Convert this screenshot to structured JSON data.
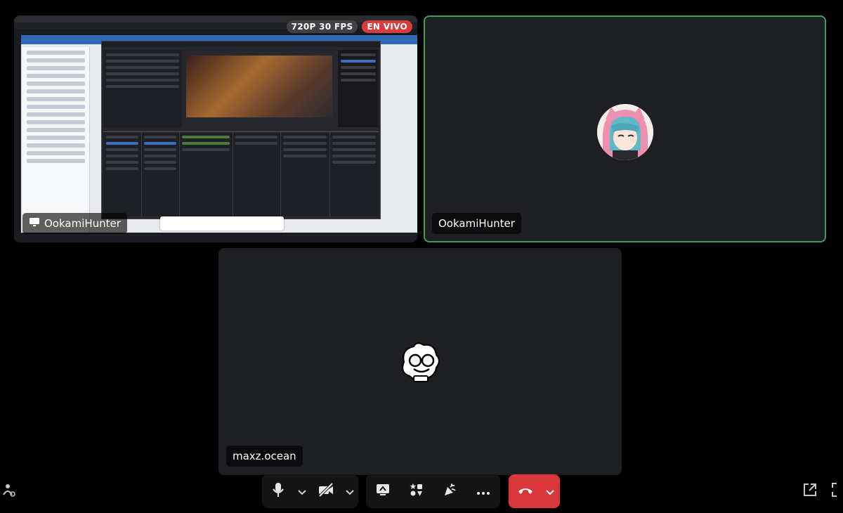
{
  "participants": [
    {
      "id": "stream",
      "name": "OokamiHunter",
      "quality": "720P 30 FPS",
      "live_label": "EN VIVO",
      "has_screen_icon": true
    },
    {
      "id": "ookami",
      "name": "OokamiHunter",
      "speaking": true
    },
    {
      "id": "maxz",
      "name": "maxz.ocean"
    }
  ],
  "controls": {
    "microphone": "microphone-icon",
    "camera": "camera-off-icon",
    "share_screen": "screen-share-icon",
    "activities": "activities-icon",
    "soundboard": "soundboard-icon",
    "more": "more-icon",
    "disconnect": "hang-up-icon"
  },
  "colors": {
    "speaking_border": "#3f9e55",
    "live_badge": "#d83c3e",
    "hangup": "#da373c",
    "tile_bg": "#1e1f22"
  }
}
